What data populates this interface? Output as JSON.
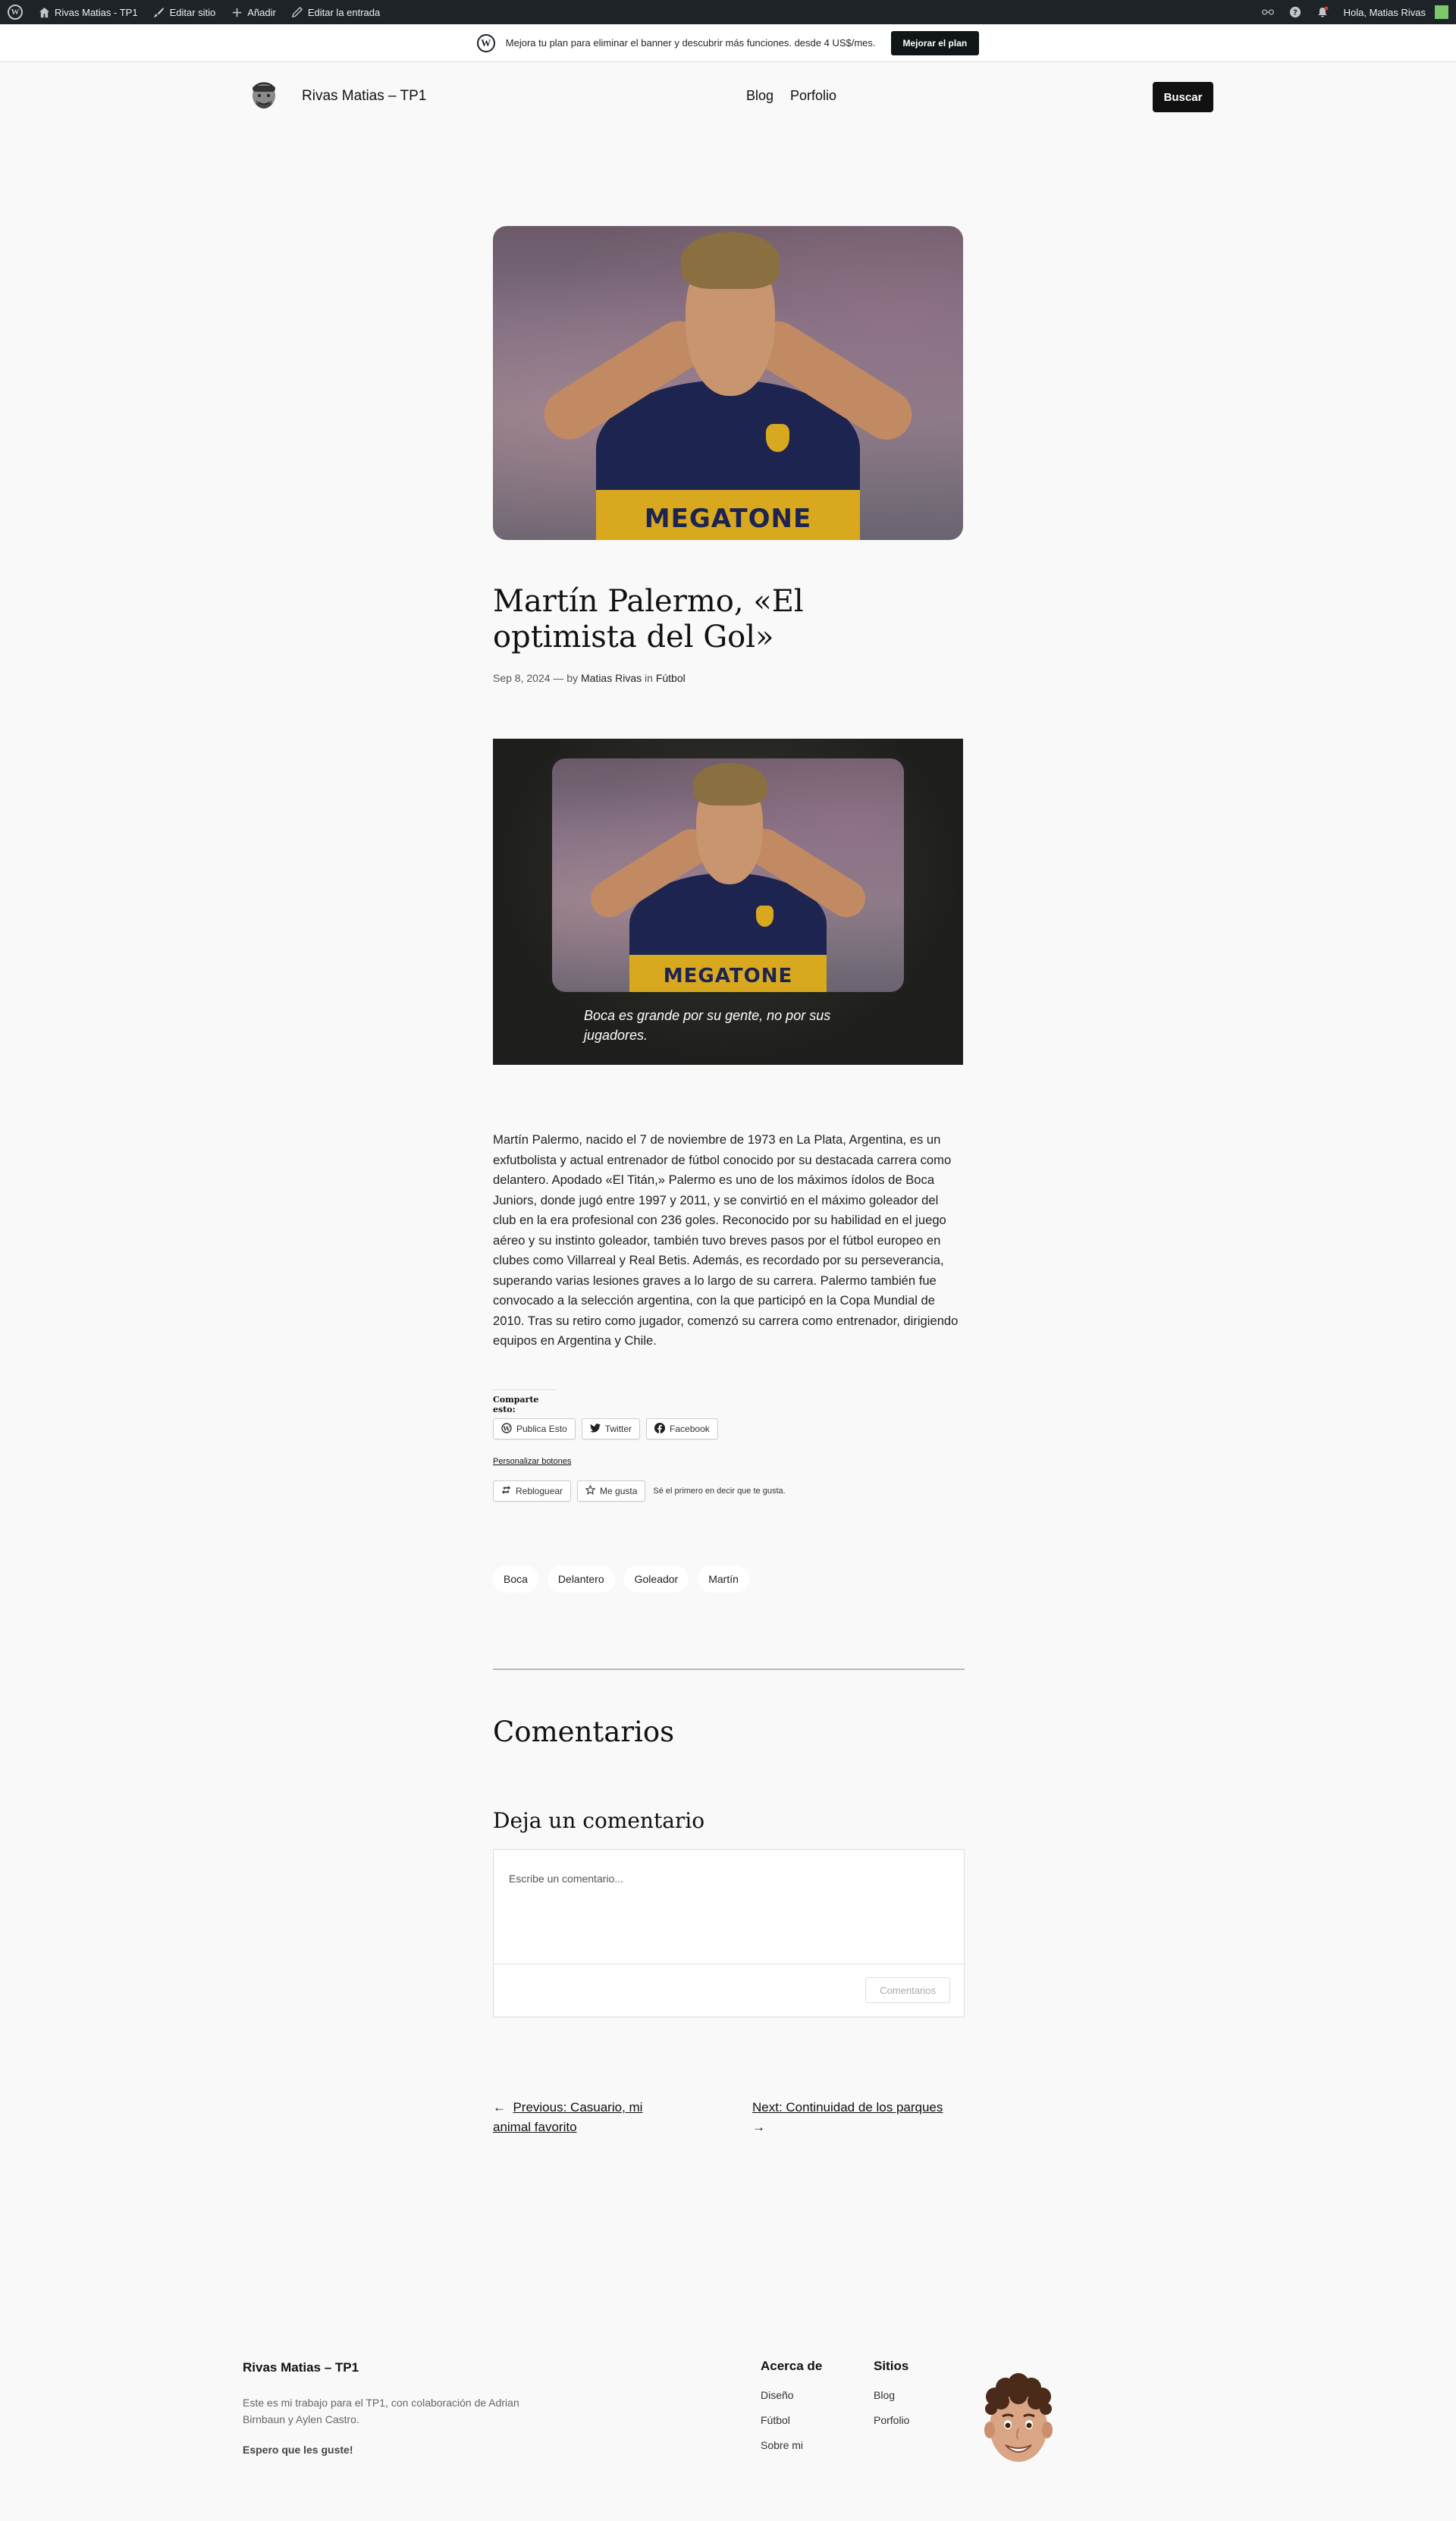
{
  "adminbar": {
    "site": "Rivas Matias - TP1",
    "edit_site": "Editar sitio",
    "add": "Añadir",
    "edit_post": "Editar la entrada",
    "greeting": "Hola, Matias Rivas"
  },
  "promo": {
    "text": "Mejora tu plan para eliminar el banner y descubrir más funciones. desde 4 US$/mes.",
    "button": "Mejorar el plan"
  },
  "header": {
    "site_title": "Rivas Matias – TP1",
    "nav": [
      "Blog",
      "Porfolio"
    ],
    "search": "Buscar"
  },
  "post": {
    "title": "Martín Palermo, «El optimista del Gol»",
    "date": "Sep 8, 2024",
    "by": "— by",
    "author": "Matias Rivas",
    "in": "in",
    "category": "Fútbol",
    "image_text": "MEGATONE",
    "cover_caption": "Boca es grande por su gente, no por sus jugadores.",
    "body": "Martín Palermo, nacido el 7 de noviembre de 1973 en La Plata, Argentina, es un exfutbolista y actual entrenador de fútbol conocido por su destacada carrera como delantero. Apodado «El Titán,» Palermo es uno de los máximos ídolos de Boca Juniors, donde jugó entre 1997 y 2011, y se convirtió en el máximo goleador del club en la era profesional con 236 goles. Reconocido por su habilidad en el juego aéreo y su instinto goleador, también tuvo breves pasos por el fútbol europeo en clubes como Villarreal y Real Betis. Además, es recordado por su perseverancia, superando varias lesiones graves a lo largo de su carrera. Palermo también fue convocado a la selección argentina, con la que participó en la Copa Mundial de 2010. Tras su retiro como jugador, comenzó su carrera como entrenador, dirigiendo equipos en Argentina y Chile."
  },
  "share": {
    "title": "Comparte esto:",
    "buttons": [
      "Publica Esto",
      "Twitter",
      "Facebook"
    ],
    "customize": "Personalizar botones",
    "reblog": "Rebloguear",
    "like": "Me gusta",
    "like_note": "Sé el primero en decir que te gusta."
  },
  "tags": [
    "Boca",
    "Delantero",
    "Goleador",
    "Martín"
  ],
  "comments": {
    "heading": "Comentarios",
    "reply_heading": "Deja un comentario",
    "placeholder": "Escribe un comentario...",
    "submit": "Comentarios"
  },
  "navigation": {
    "previous": "Previous: Casuario, mi animal favorito",
    "next": "Next: Continuidad de los parques"
  },
  "footer": {
    "title": "Rivas Matias – TP1",
    "description": "Este es mi trabajo para el TP1, con colaboración de Adrian Birnbaun y Aylen Castro.",
    "hope": "Espero que les guste!",
    "col1": {
      "heading": "Acerca de",
      "links": [
        "Diseño",
        "Fútbol",
        "Sobre mi"
      ]
    },
    "col2": {
      "heading": "Sitios",
      "links": [
        "Blog",
        "Porfolio"
      ]
    }
  },
  "colors": {
    "background": "#f9f9f9",
    "adminbar": "#1d2327",
    "button_dark": "#111111",
    "boca_blue": "#1d2450",
    "boca_gold": "#d8a81f"
  },
  "icons": [
    "wordpress-icon",
    "home-icon",
    "brush-icon",
    "plus-icon",
    "pencil-icon",
    "reader-icon",
    "help-icon",
    "bell-icon",
    "twitter-icon",
    "facebook-icon",
    "reblog-icon",
    "star-icon",
    "arrow-left-icon",
    "arrow-right-icon"
  ]
}
